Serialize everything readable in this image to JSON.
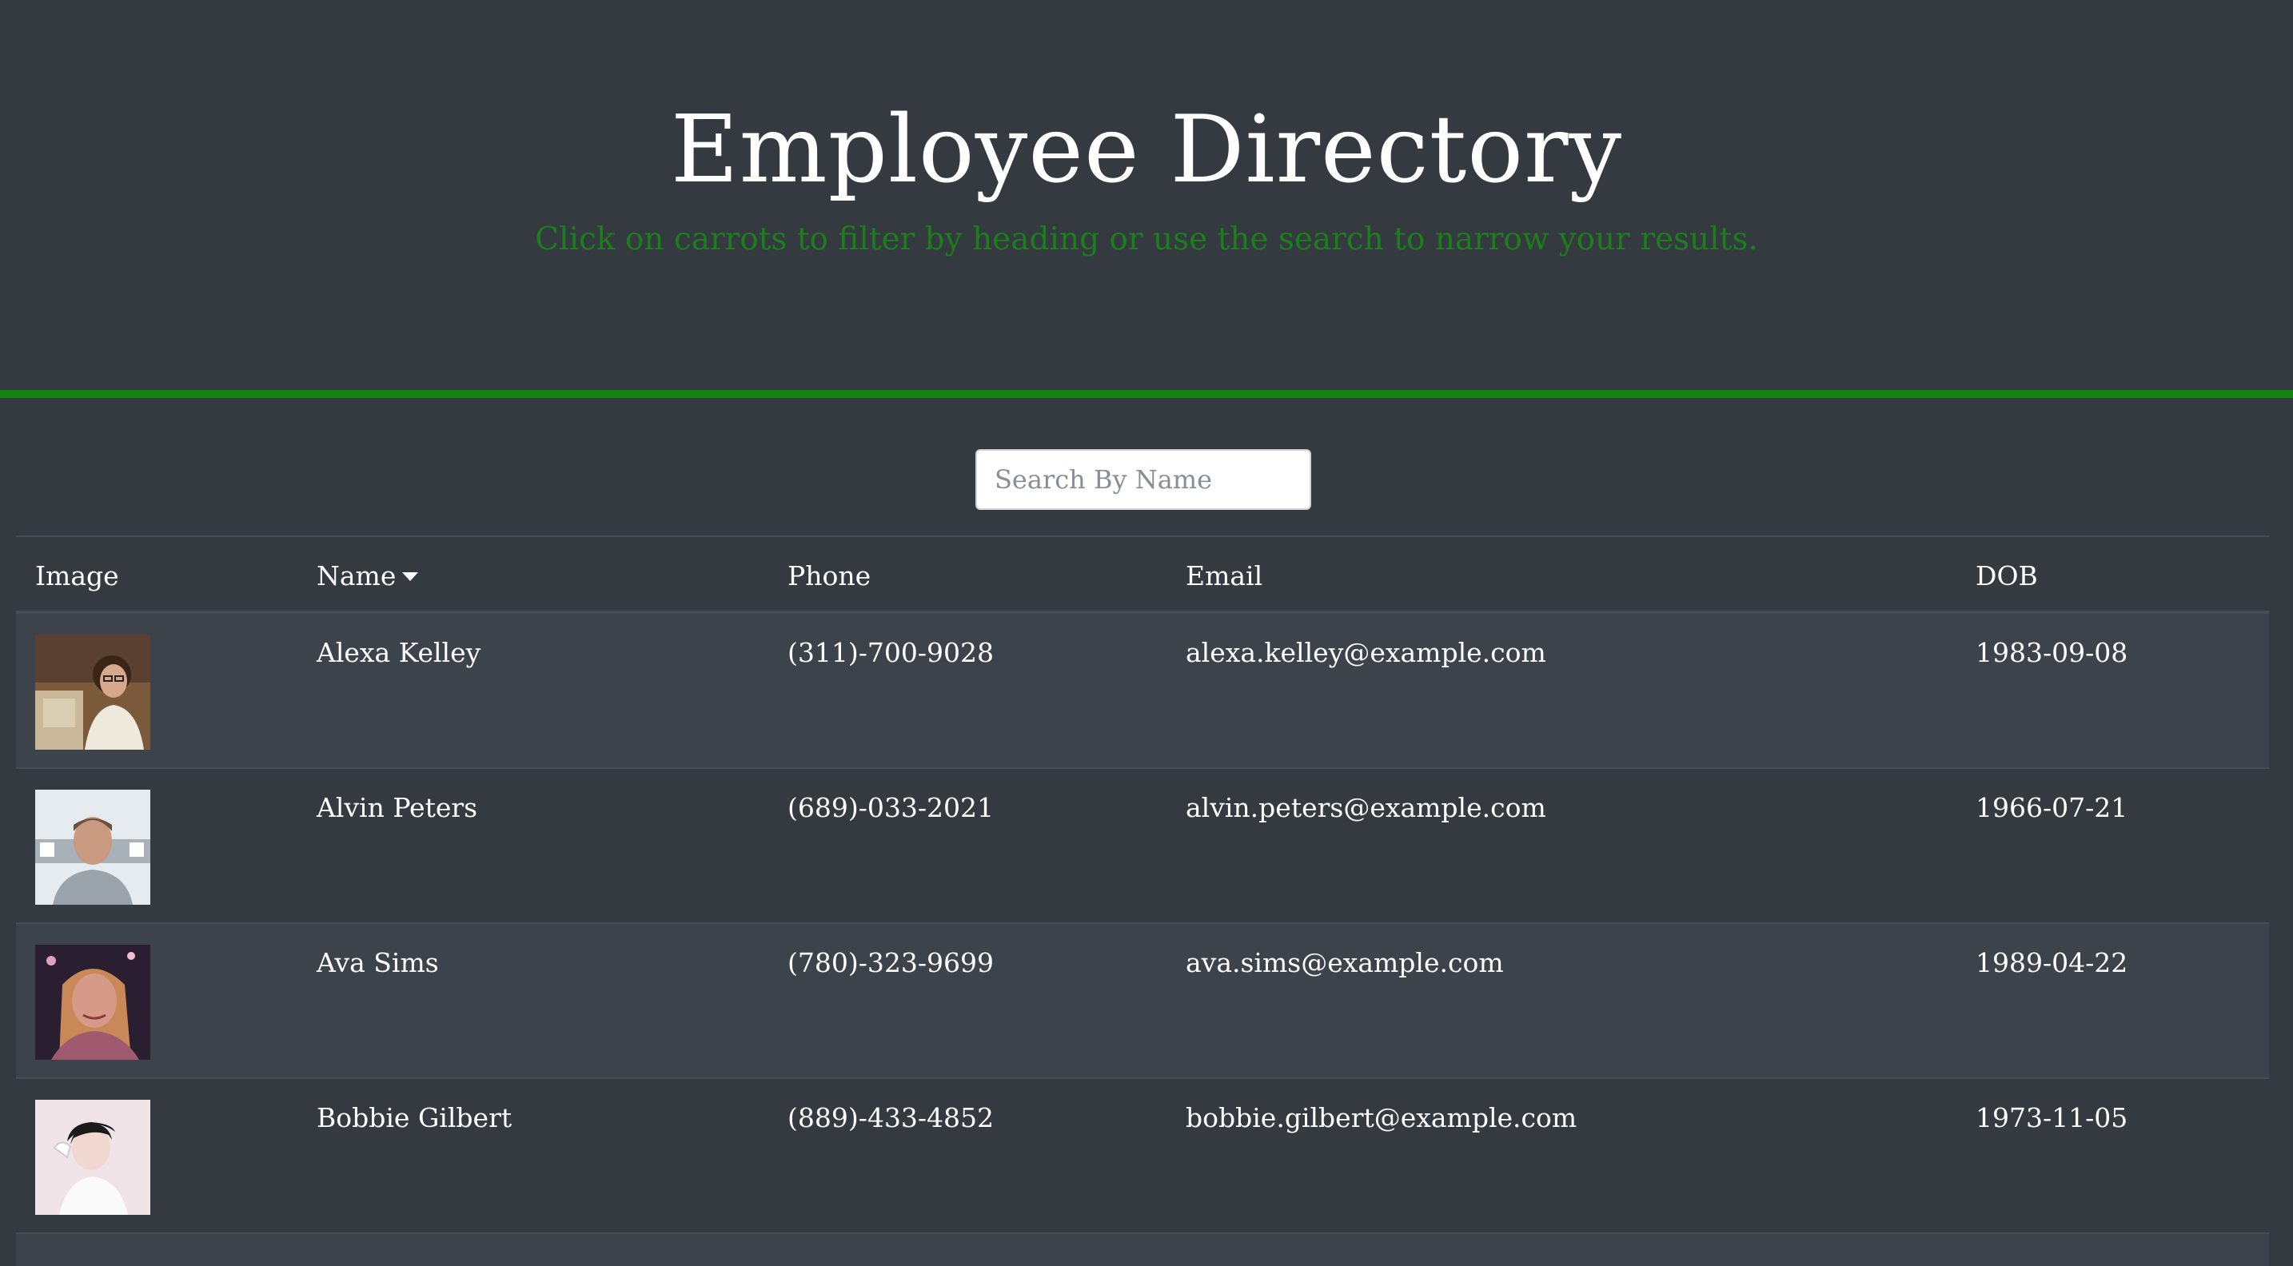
{
  "header": {
    "title": "Employee Directory",
    "subtitle": "Click on carrots to filter by heading or use the search to narrow your results."
  },
  "search": {
    "placeholder": "Search By Name",
    "value": ""
  },
  "table": {
    "columns": [
      "Image",
      "Name",
      "Phone",
      "Email",
      "DOB"
    ],
    "sort": {
      "column": "Name",
      "icon": "caret-down-icon"
    },
    "rows": [
      {
        "name": "Alexa Kelley",
        "phone": "(311)-700-9028",
        "email": "alexa.kelley@example.com",
        "dob": "1983-09-08"
      },
      {
        "name": "Alvin Peters",
        "phone": "(689)-033-2021",
        "email": "alvin.peters@example.com",
        "dob": "1966-07-21"
      },
      {
        "name": "Ava Sims",
        "phone": "(780)-323-9699",
        "email": "ava.sims@example.com",
        "dob": "1989-04-22"
      },
      {
        "name": "Bobbie Gilbert",
        "phone": "(889)-433-4852",
        "email": "bobbie.gilbert@example.com",
        "dob": "1973-11-05"
      }
    ]
  },
  "colors": {
    "background": "#343a40",
    "accent": "#148214",
    "subtitle": "#1a7f1a",
    "row_stripe": "#3d434a"
  }
}
